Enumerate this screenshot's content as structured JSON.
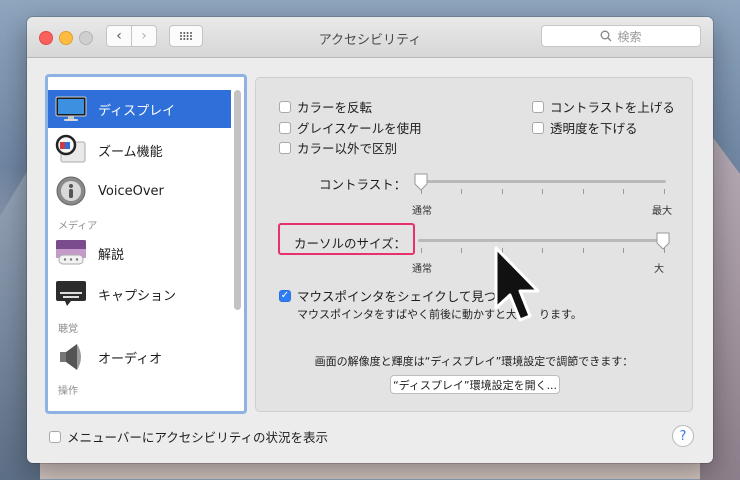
{
  "window": {
    "title": "アクセシビリティ",
    "search_placeholder": "検索"
  },
  "sidebar": {
    "items": [
      {
        "label": "ディスプレイ",
        "icon": "display-icon",
        "selected": true
      },
      {
        "label": "ズーム機能",
        "icon": "zoom-icon"
      },
      {
        "label": "VoiceOver",
        "icon": "voiceover-icon"
      },
      {
        "label": "解説",
        "icon": "description-icon"
      },
      {
        "label": "キャプション",
        "icon": "captions-icon"
      },
      {
        "label": "オーディオ",
        "icon": "speaker-icon"
      }
    ],
    "categories": {
      "media": "メディア",
      "hearing": "聴覚",
      "interaction": "操作"
    }
  },
  "display": {
    "options_left": [
      "カラーを反転",
      "グレイスケールを使用",
      "カラー以外で区別"
    ],
    "options_right": [
      "コントラストを上げる",
      "透明度を下げる"
    ],
    "contrast": {
      "label": "コントラスト：",
      "min_label": "通常",
      "max_label": "最大",
      "value_fraction": 0
    },
    "cursor_size": {
      "label": "カーソルのサイズ：",
      "min_label": "通常",
      "max_label": "大",
      "value_fraction": 1
    },
    "shake_option": {
      "label": "マウスポインタをシェイクして見つ",
      "checked": true,
      "note": "マウスポインタをすばやく前後に動かすと大き",
      "note_tail": "ります。"
    },
    "resolution_info": "画面の解像度と輝度は“ディスプレイ”環境設定で調節できます：",
    "open_display_button": "“ディスプレイ”環境設定を開く..."
  },
  "footer": {
    "menubar_option": "メニューバーにアクセシビリティの状況を表示",
    "help": "?"
  },
  "colors": {
    "selection": "#2e6fd9",
    "highlight": "#e8306a",
    "checkbox_checked": "#2f7df6"
  }
}
